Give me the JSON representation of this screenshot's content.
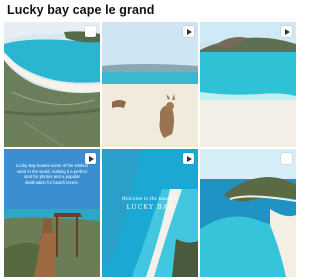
{
  "page": {
    "title": "Lucky bay cape le grand"
  },
  "tiles": [
    {
      "id": "bay-aerial",
      "badge": "square"
    },
    {
      "id": "kangaroo-beach",
      "badge": "play"
    },
    {
      "id": "turquoise-shore",
      "badge": "play"
    },
    {
      "id": "stairs-promo",
      "badge": "play",
      "overlay": "Lucky Bay boasts some of the whitest sand in the world, making it a perfect spot for photos and a popular destination for beach lovers."
    },
    {
      "id": "lucky-bay-aerial",
      "badge": "play",
      "script_top": "Welcome to the beach of",
      "script_bottom": "LUCKY BAY"
    },
    {
      "id": "headland-water",
      "badge": "square"
    }
  ],
  "colors": {
    "sea": "#2fb8d6",
    "sand": "#f4ede0",
    "sky": "#e8f2f7"
  }
}
